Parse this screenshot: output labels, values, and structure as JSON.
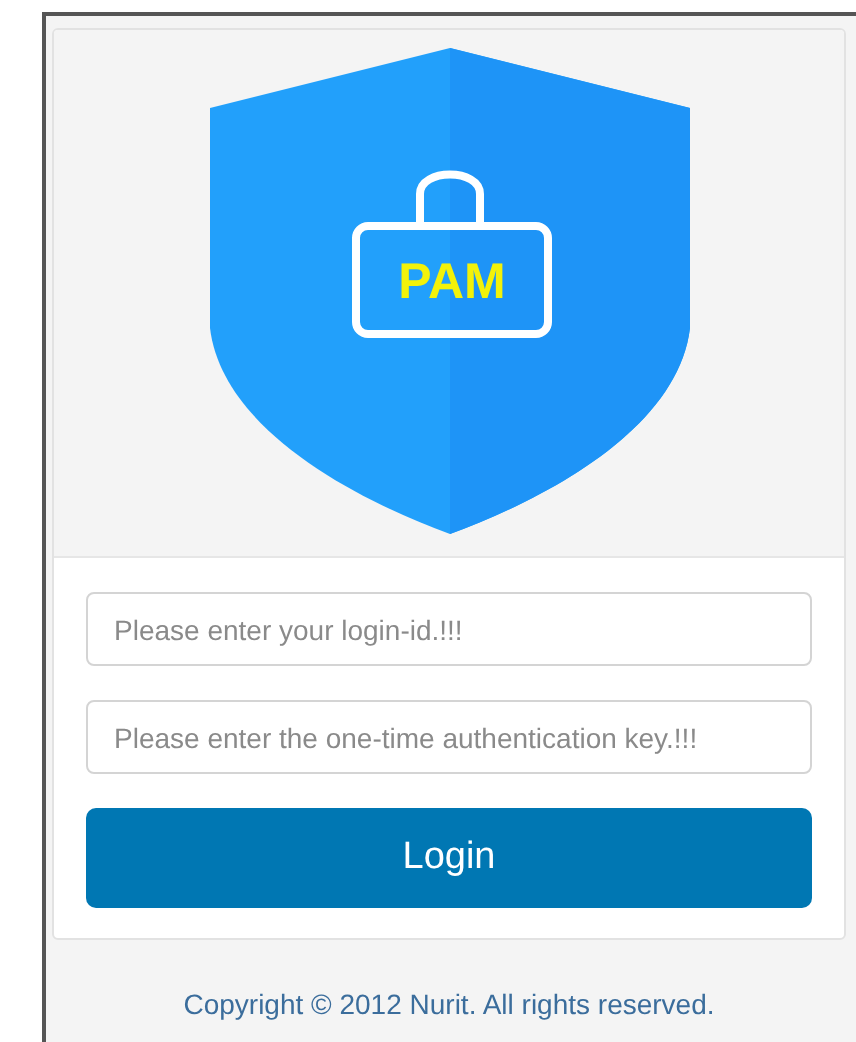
{
  "logo": {
    "text": "PAM"
  },
  "fields": [
    {
      "placeholder": "Please enter your login-id.!!!"
    },
    {
      "placeholder": "Please enter the one-time authentication key.!!!"
    }
  ],
  "login_button": {
    "label": "Login"
  },
  "footer": {
    "copyright": "Copyright © 2012 Nurit. All rights reserved."
  }
}
